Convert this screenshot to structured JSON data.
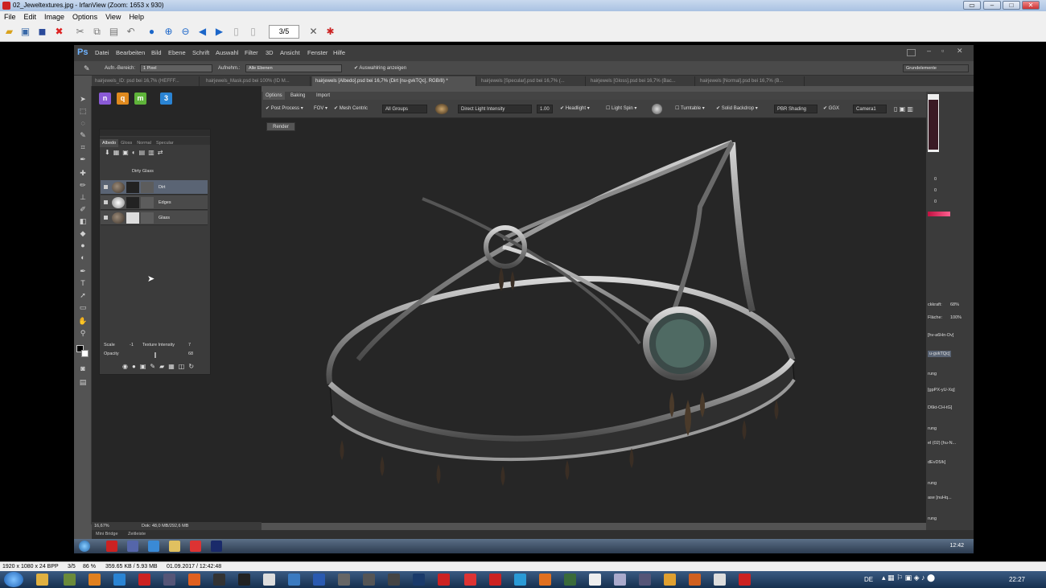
{
  "irfanview": {
    "title": "02_Jeweltextures.jpg - IrfanView (Zoom: 1653 x 930)",
    "menu": [
      "File",
      "Edit",
      "Image",
      "Options",
      "View",
      "Help"
    ],
    "page_counter": "3/5",
    "status": {
      "dimensions": "1920 x 1080 x 24 BPP",
      "index": "3/5",
      "zoom": "86 %",
      "filesize": "359.65 KB / 5.93 MB",
      "date": "01.09.2017 / 12:42:48"
    }
  },
  "photoshop": {
    "logo": "Ps",
    "menu": [
      "Datei",
      "Bearbeiten",
      "Bild",
      "Ebene",
      "Schrift",
      "Auswahl",
      "Filter",
      "3D",
      "Ansicht",
      "Fenster",
      "Hilfe"
    ],
    "options": {
      "sample_size_label": "Aufn.-Bereich:",
      "sample_size_value": "1 Pixel",
      "sample_label": "Aufnehm.:",
      "sample_value": "Alle Ebenen",
      "show_ring": "Auswahlring anzeigen",
      "workspace": "Grundelemente"
    },
    "tabs": [
      {
        "label": "hairjewels_ID: psd bei 16,7% (HEFFF...",
        "active": false
      },
      {
        "label": "hairjewels_Mask.psd bei 100% (ID M...",
        "active": false
      },
      {
        "label": "hairjewels [Albedo].psd bei 16,7% (Dirt [nu-gvkTQc], RGB/8) *",
        "active": true
      },
      {
        "label": "hairjewels [Specular].psd bei 16,7% (...",
        "active": false
      },
      {
        "label": "hairjewels [Gloss].psd bei 16,7% (Bac...",
        "active": false
      },
      {
        "label": "hairjewels [Normal].psd bei 16,7% (B...",
        "active": false
      }
    ],
    "plugins": [
      {
        "letter": "n",
        "color": "#8a5ad6"
      },
      {
        "letter": "q",
        "color": "#e08a1e"
      },
      {
        "letter": "m",
        "color": "#5fb33a"
      },
      {
        "letter": "3",
        "color": "#2a84d4"
      }
    ],
    "layers_panel": {
      "tabs": [
        "Albedo",
        "Gloss",
        "Normal",
        "Specular"
      ],
      "group": "Dirty Glass",
      "layers": [
        {
          "name": "Dirt",
          "selected": true
        },
        {
          "name": "Edges",
          "selected": false
        },
        {
          "name": "Glass",
          "selected": false
        }
      ],
      "scale_label": "Scale",
      "scale_value": "-1",
      "texture_intensity_label": "Texture Intensity",
      "texture_intensity_value": "7",
      "opacity_label": "Opacity",
      "opacity_value": "68"
    },
    "status": {
      "zoom": "16,67%",
      "doc": "Dok: 48,0 MB/292,6 MB"
    },
    "bottom_tabs": [
      "Mini Bridge",
      "Zeitleiste"
    ]
  },
  "viewer": {
    "tabs": [
      "Options",
      "Baking",
      "Import"
    ],
    "toolbar": {
      "post_process": "Post Process",
      "fov": "FOV",
      "mesh_centric": "Mesh Centric",
      "all_groups": "All Groups",
      "direct_light": "Direct Light Intensity",
      "direct_light_value": "1.00",
      "headlight": "Headlight",
      "light_spin": "Light Spin",
      "turntable": "Turntable",
      "solid_backdrop": "Solid Backdrop",
      "pbr_shading": "PBR Shading",
      "ggx": "GGX",
      "camera": "Camera1"
    },
    "render_button": "Render"
  },
  "right_panel": {
    "rgb": [
      "0",
      "0",
      "0"
    ],
    "deckkraft_label": "ckkraft:",
    "deckkraft_value": "68%",
    "flaeche_label": "Fläche:",
    "flaeche_value": "100%",
    "layers": [
      "[hv-a6Hn-Dv]",
      "u-gvkTQc]",
      "rung",
      "[gpPX-yU-Xq]",
      "D6kt-CH-tG]",
      "rung",
      "el (02) [hu-N...",
      "dEvD5/k]",
      "rung",
      "ase [nuHq...",
      "rung"
    ]
  },
  "inner_taskbar": {
    "clock": "12:42"
  },
  "windows_taskbar": {
    "lang": "DE",
    "clock": "22:27"
  }
}
